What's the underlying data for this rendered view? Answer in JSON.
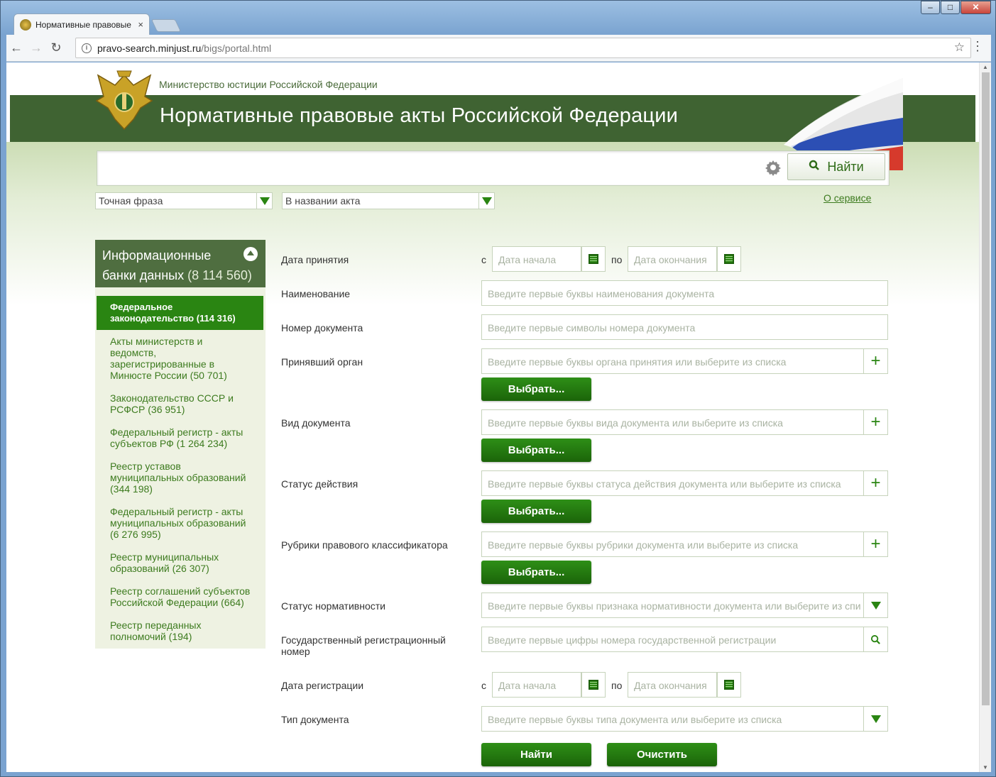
{
  "browser": {
    "tab_title": "Нормативные правовые",
    "url_host": "pravo-search.minjust.ru",
    "url_path": "/bigs/portal.html",
    "close_label": "×"
  },
  "window_controls": {
    "min": "–",
    "max": "□",
    "close": "✕"
  },
  "header": {
    "ministry": "Министерство юстиции Российской Федерации",
    "title": "Нормативные правовые акты Российской Федерации"
  },
  "search": {
    "button_label": "Найти",
    "mode": "Точная фраза",
    "scope": "В названии акта",
    "about_link": "О сервисе"
  },
  "sidebar": {
    "title_line1": "Информационные",
    "title_line2": "банки данных",
    "title_count": "(8 114 560)",
    "active": "Федеральное законодательство (114 316)",
    "items": [
      "Акты министерств и ведомств, зарегистрированные в Минюсте России (50 701)",
      "Законодательство СССР и РСФСР (36 951)",
      "Федеральный регистр - акты субъектов РФ (1 264 234)",
      "Реестр уставов муниципальных образований (344 198)",
      "Федеральный регистр - акты муниципальных образований (6 276 995)",
      "Реестр муниципальных образований (26 307)",
      "Реестр соглашений субъектов Российской Федерации (664)",
      "Реестр переданных полномочий (194)"
    ]
  },
  "form": {
    "c": "с",
    "po": "по",
    "date_start": "Дата начала",
    "date_end": "Дата окончания",
    "choose": "Выбрать...",
    "labels": {
      "adoption_date": "Дата принятия",
      "name": "Наименование",
      "doc_number": "Номер документа",
      "authority": "Принявший орган",
      "doc_kind": "Вид документа",
      "status": "Статус действия",
      "rubrics": "Рубрики правового классификатора",
      "normativity": "Статус нормативности",
      "reg_number": "Государственный регистрационный номер",
      "reg_date": "Дата регистрации",
      "doc_type": "Тип документа"
    },
    "placeholders": {
      "name": "Введите первые буквы наименования документа",
      "doc_number": "Введите первые символы номера документа",
      "authority": "Введите первые буквы органа принятия или выберите из списка",
      "doc_kind": "Введите первые буквы вида документа или выберите из списка",
      "status": "Введите первые буквы статуса действия документа или выберите из списка",
      "rubrics": "Введите первые буквы рубрики документа или выберите из списка",
      "normativity": "Введите первые буквы признака нормативности документа или выберите из спи",
      "reg_number": "Введите первые цифры номера государственной регистрации",
      "doc_type": "Введите первые буквы типа документа или выберите из списка"
    },
    "submit": "Найти",
    "clear": "Очистить"
  }
}
